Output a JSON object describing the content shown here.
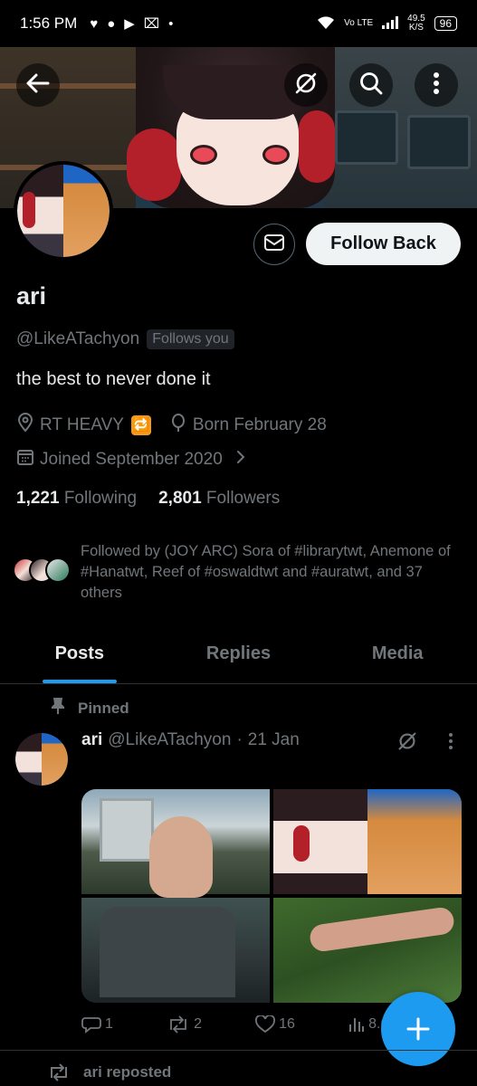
{
  "status_bar": {
    "time": "1:56 PM",
    "network": "Vo LTE",
    "net_speed_value": "49.5",
    "net_speed_unit": "K/S",
    "battery": "96"
  },
  "profile": {
    "name": "ari",
    "handle": "@LikeATachyon",
    "follows_you": "Follows you",
    "bio": "the best to never done it",
    "location": "RT HEAVY",
    "location_emoji": "🔁",
    "birthday": "Born February 28",
    "joined": "Joined September 2020",
    "following_count": "1,221",
    "following_label": "Following",
    "followers_count": "2,801",
    "followers_label": "Followers",
    "followed_by": "Followed by (JOY ARC) Sora of #librarytwt, Anemone of #Hanatwt, Reef of #oswaldtwt and #auratwt, and 37 others",
    "follow_button": "Follow Back"
  },
  "tabs": [
    {
      "label": "Posts",
      "active": true
    },
    {
      "label": "Replies",
      "active": false
    },
    {
      "label": "Media",
      "active": false
    }
  ],
  "pinned_tweet": {
    "pinned_label": "Pinned",
    "author_name": "ari",
    "author_handle": "@LikeATachyon",
    "separator": "·",
    "date": "21 Jan",
    "replies": "1",
    "retweets": "2",
    "likes": "16",
    "views": "8.6K"
  },
  "next_item": {
    "reposted_label": "ari reposted"
  },
  "icons": [
    "back-arrow-icon",
    "grok-icon",
    "search-icon",
    "more-vertical-icon",
    "mail-icon",
    "location-icon",
    "birthday-icon",
    "calendar-icon",
    "chevron-right-icon",
    "pin-icon",
    "reply-icon",
    "retweet-icon",
    "like-icon",
    "views-icon",
    "plus-icon"
  ],
  "colors": {
    "accent": "#1d9bf0",
    "background": "#000000",
    "muted_text": "#71767b",
    "primary_text": "#e7e9ea"
  }
}
